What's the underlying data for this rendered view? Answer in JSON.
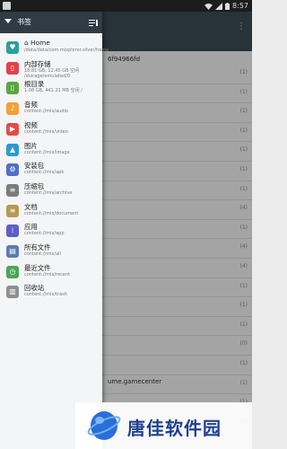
{
  "status_bar": {
    "time": "8:57"
  },
  "drawer": {
    "title": "书签",
    "items": [
      {
        "label": "⌂ Home",
        "detail": "/data/data/com.mixplorer.silver/home",
        "icon": "home-icon",
        "color": "#2aa198"
      },
      {
        "label": "内部存储",
        "detail": "18.81 GB, 12.45 GB 空闲 /storage/emulated/0",
        "icon": "phone-storage-icon",
        "color": "#e0414a"
      },
      {
        "label": "根目录",
        "detail": "1.08 GB, 441.21 MB 空闲 /",
        "icon": "root-icon",
        "color": "#5aa63c"
      },
      {
        "label": "音频",
        "detail": "content://mix/audio",
        "icon": "music-icon",
        "color": "#f2a03a"
      },
      {
        "label": "视频",
        "detail": "content://mix/video",
        "icon": "video-icon",
        "color": "#e54b4b"
      },
      {
        "label": "图片",
        "detail": "content://mix/image",
        "icon": "image-icon",
        "color": "#2a9ad6"
      },
      {
        "label": "安装包",
        "detail": "content://mix/apk",
        "icon": "android-icon",
        "color": "#4f6fc9"
      },
      {
        "label": "压缩包",
        "detail": "content://mix/archive",
        "icon": "archive-icon",
        "color": "#7c7c7c"
      },
      {
        "label": "文档",
        "detail": "content://mix/document",
        "icon": "document-icon",
        "color": "#b79a52"
      },
      {
        "label": "应用",
        "detail": "content://mix/app",
        "icon": "apps-icon",
        "color": "#5c5fc7"
      },
      {
        "label": "所有文件",
        "detail": "content://mix/all",
        "icon": "all-files-icon",
        "color": "#5b7cb1"
      },
      {
        "label": "最近文件",
        "detail": "content://mix/recent",
        "icon": "recent-icon",
        "color": "#48a656"
      },
      {
        "label": "回收站",
        "detail": "content://mix/trash",
        "icon": "trash-icon",
        "color": "#8e8e8e"
      }
    ]
  },
  "background_list": {
    "top_text": "6f94966fd",
    "bottom_text": "ume.gamecenter",
    "counts": [
      "(1)",
      "(1)",
      "(1)",
      "(1)",
      "(1)",
      "(1)",
      "(1)",
      "(4)",
      "(1)",
      "(4)",
      "(4)",
      "(1)",
      "(1)",
      "(1)",
      "(0)",
      "(1)",
      "(1)",
      "(1)",
      "(1)"
    ]
  },
  "watermark": {
    "text": "唐佳软件园"
  }
}
